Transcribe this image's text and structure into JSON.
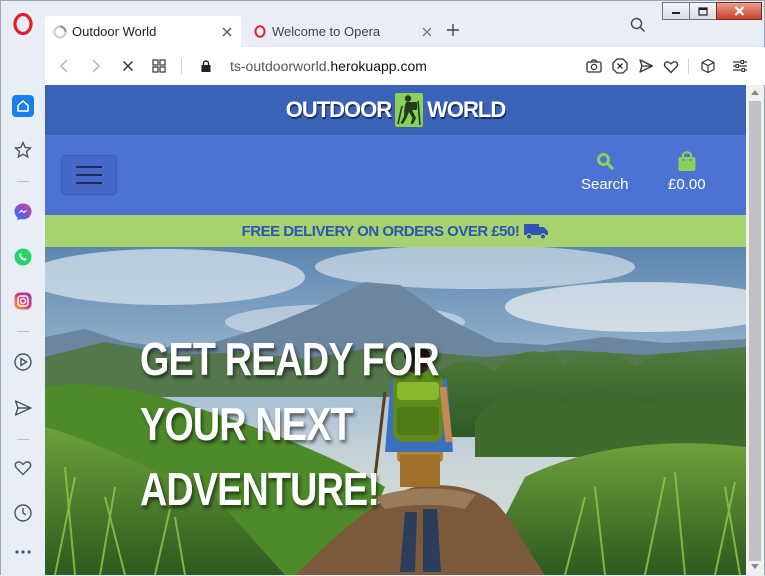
{
  "browser": {
    "tabs": [
      {
        "title": "Outdoor World",
        "active": true,
        "loading": true
      },
      {
        "title": "Welcome to Opera",
        "active": false
      }
    ],
    "url_prefix": "ts-outdoorworld.",
    "url_domain": "herokuapp.com",
    "icons": {
      "sidebar": [
        "opera-logo-icon",
        "home-icon",
        "star-icon",
        "messenger-icon",
        "whatsapp-icon",
        "instagram-icon",
        "player-icon",
        "send-icon",
        "heart-icon",
        "history-icon",
        "more-icon"
      ],
      "toolbar": [
        "back-icon",
        "forward-icon",
        "stop-icon",
        "tab-grid-icon",
        "lock-icon",
        "camera-icon",
        "adblock-icon",
        "send-icon",
        "heart-icon",
        "cube-icon",
        "settings-icon"
      ]
    }
  },
  "site": {
    "logo_left": "OUTDOOR",
    "logo_right": "WORLD",
    "nav": {
      "search_label": "Search",
      "basket_total": "£0.00"
    },
    "promo_text": "FREE DELIVERY ON ORDERS OVER £50!",
    "hero_lines": [
      "GET READY FOR",
      "YOUR NEXT",
      "ADVENTURE!"
    ],
    "colors": {
      "header": "#3a63b8",
      "nav": "#4c72d4",
      "promo_bg": "#a6d36d",
      "promo_text": "#3054b4",
      "accent_green": "#8bd05a"
    }
  }
}
